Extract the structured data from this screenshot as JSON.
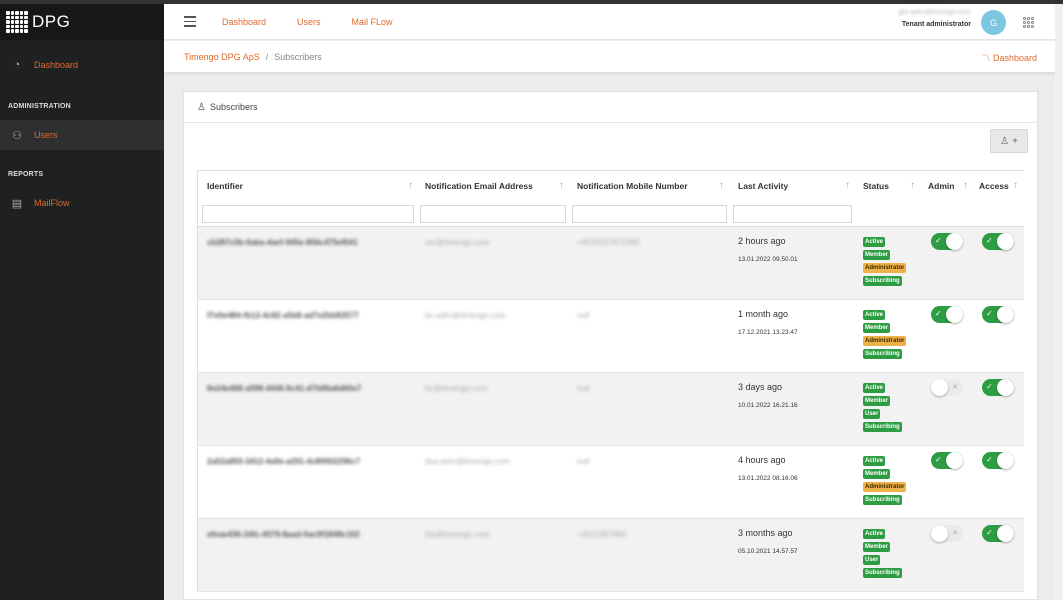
{
  "brand": {
    "name": "DPG"
  },
  "sidebar": {
    "items": [
      {
        "label": "Dashboard",
        "icon": "gauge-icon"
      }
    ],
    "sections": [
      {
        "title": "ADMINISTRATION",
        "items": [
          {
            "label": "Users",
            "icon": "users-icon"
          }
        ]
      },
      {
        "title": "REPORTS",
        "items": [
          {
            "label": "MailFlow",
            "icon": "table-icon"
          }
        ]
      }
    ]
  },
  "header": {
    "links": [
      "Dashboard",
      "Users",
      "Mail FLow"
    ],
    "user_email": "gbl-adm@timengo.com",
    "user_role": "Tenant administrator",
    "avatar_initial": "G"
  },
  "breadcrumb": {
    "root": "Timengo DPG ApS",
    "separator": "/",
    "current": "Subscribers",
    "right_link": "Dashboard"
  },
  "card": {
    "title": "Subscribers",
    "add_button_plus": "+"
  },
  "table": {
    "columns": [
      "Identifier",
      "Notification Email Address",
      "Notification Mobile Number",
      "Last Activity",
      "Status",
      "Admin",
      "Access"
    ],
    "sort_glyph": "↑",
    "rows": [
      {
        "identifier": "cb287c0b-0aba-4aef-945e-856c475ef041",
        "email": "asr@timengo.com",
        "mobile": "+4526257871080",
        "last_rel": "2 hours ago",
        "last_date": "13.01.2022 09.50.01",
        "status": [
          "Active",
          "Member",
          "Administrator",
          "Subscribing"
        ],
        "admin": true,
        "access": true
      },
      {
        "identifier": "f7e5e484-fb12-4c82-a5b8-ad7e2bb82577",
        "email": "bc-adm@timengo.com",
        "mobile": "null",
        "last_rel": "1 month ago",
        "last_date": "17.12.2021 13.23.47",
        "status": [
          "Active",
          "Member",
          "Administrator",
          "Subscribing"
        ],
        "admin": true,
        "access": true
      },
      {
        "identifier": "8e24e468-a598-4446-9c41-d7b86a6d60e7",
        "email": "bc@timengo.com",
        "mobile": "null",
        "last_rel": "3 days ago",
        "last_date": "10.01.2022 16.21.16",
        "status": [
          "Active",
          "Member",
          "User",
          "Subscribing"
        ],
        "admin": false,
        "access": true
      },
      {
        "identifier": "2a52a893-3412-4a9e-a291-4c89002296c7",
        "email": "dsa-adm@timengo.com",
        "mobile": "null",
        "last_rel": "4 hours ago",
        "last_date": "13.01.2022 08.16.06",
        "status": [
          "Active",
          "Member",
          "Administrator",
          "Subscribing"
        ],
        "admin": true,
        "access": true
      },
      {
        "identifier": "efeae436-24fc-4579-8aad-0ac0f1848c162",
        "email": "bla@timengo.com",
        "mobile": "+4521897884",
        "last_rel": "3 months ago",
        "last_date": "05.10.2021 14.57.57",
        "status": [
          "Active",
          "Member",
          "User",
          "Subscribing"
        ],
        "admin": false,
        "access": true
      }
    ]
  },
  "colors": {
    "accent": "#e06a2b",
    "success": "#2d9c43",
    "warning": "#efb24a",
    "sidebar_bg": "#1f2021"
  }
}
